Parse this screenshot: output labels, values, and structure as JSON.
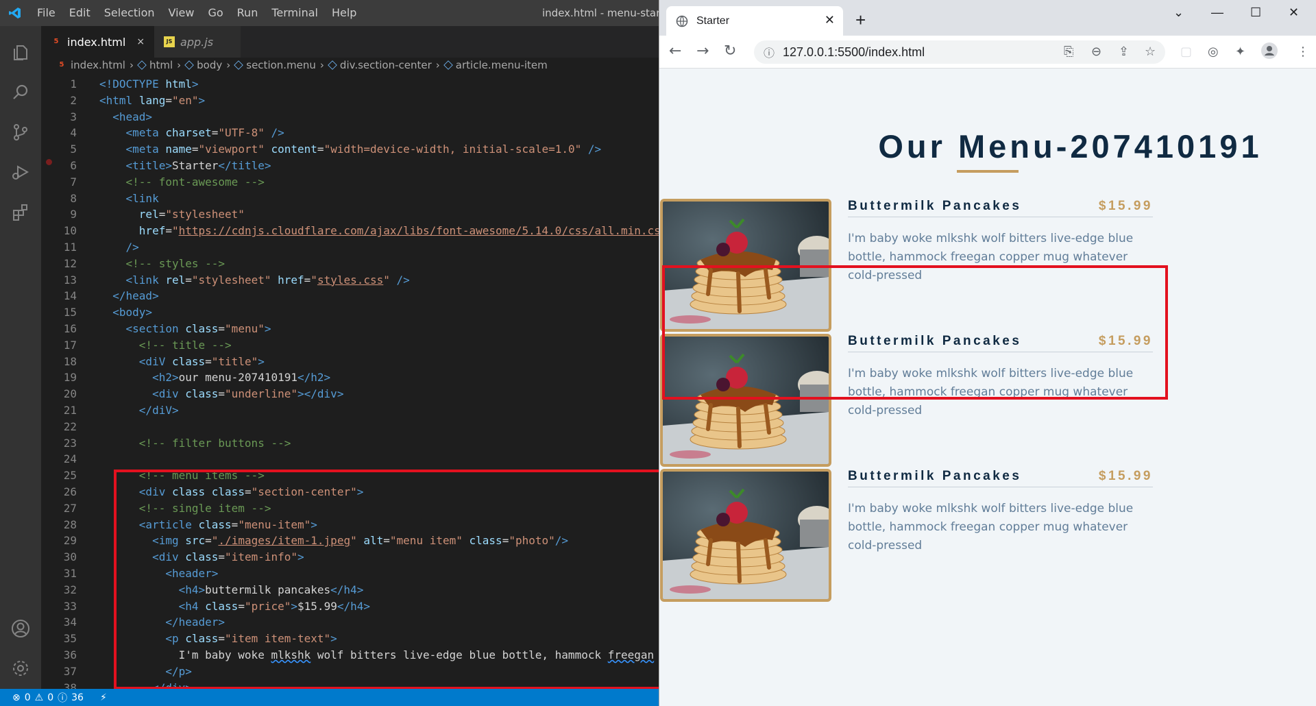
{
  "vscode": {
    "menu": [
      "File",
      "Edit",
      "Selection",
      "View",
      "Go",
      "Run",
      "Terminal",
      "Help"
    ],
    "window_title": "index.html - menu-starte",
    "tabs": [
      {
        "badge": "5",
        "label": "index.html",
        "close": "×"
      },
      {
        "badge": "JS",
        "label": "app.js"
      }
    ],
    "breadcrumb": [
      "index.html",
      "html",
      "body",
      "section.menu",
      "div.section-center",
      "article.menu-item"
    ],
    "line_numbers": [
      "1",
      "2",
      "3",
      "4",
      "5",
      "6",
      "7",
      "8",
      "9",
      "10",
      "11",
      "12",
      "13",
      "14",
      "15",
      "16",
      "17",
      "18",
      "19",
      "20",
      "21",
      "22",
      "23",
      "24",
      "25",
      "26",
      "27",
      "28",
      "29",
      "30",
      "31",
      "32",
      "33",
      "34",
      "35",
      "36",
      "37",
      "38"
    ],
    "status": {
      "errors": "0",
      "warnings": "0",
      "info": "36"
    },
    "icons": [
      "files-icon",
      "search-icon",
      "source-control-icon",
      "run-debug-icon",
      "extensions-icon",
      "account-icon",
      "settings-gear-icon"
    ]
  },
  "browser": {
    "tab_title": "Starter",
    "url": "127.0.0.1:5500/index.html",
    "page": {
      "title": "Our Menu-207410191",
      "items": [
        {
          "name": "Buttermilk Pancakes",
          "price": "$15.99",
          "text": "I'm baby woke mlkshk wolf bitters live-edge blue bottle, hammock freegan copper mug whatever cold-pressed"
        },
        {
          "name": "Buttermilk Pancakes",
          "price": "$15.99",
          "text": "I'm baby woke mlkshk wolf bitters live-edge blue bottle, hammock freegan copper mug whatever cold-pressed"
        },
        {
          "name": "Buttermilk Pancakes",
          "price": "$15.99",
          "text": "I'm baby woke mlkshk wolf bitters live-edge blue bottle, hammock freegan copper mug whatever cold-pressed"
        }
      ]
    }
  },
  "colors": {
    "accent": "#c59d5f",
    "highlight": "#e3111f",
    "statusbar": "#007acc",
    "title": "#102a42"
  }
}
